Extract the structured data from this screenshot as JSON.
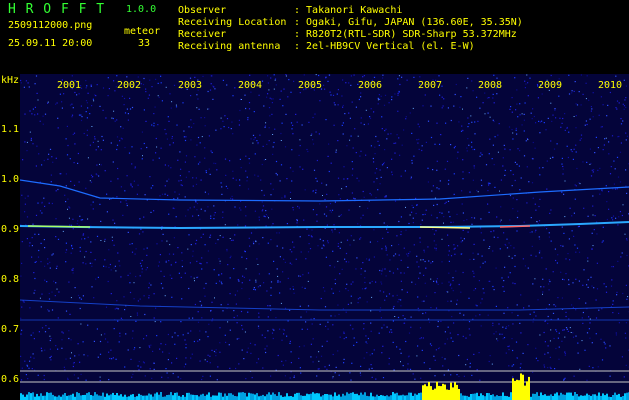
{
  "app": {
    "title": "H R O F F T",
    "version": "1.0.0",
    "filename": "2509112000.png",
    "datetime": "25.09.11 20:00",
    "meteor_label": "meteor",
    "meteor_count": "33"
  },
  "info": {
    "labels": [
      "Observer",
      "Receiving Location",
      "Receiver",
      "Receiving antenna"
    ],
    "values": [
      ": Takanori Kawachi",
      ": Ogaki, Gifu, JAPAN (136.60E, 35.35N)",
      ": R820T2(RTL-SDR) SDR-Sharp 53.372MHz",
      ": 2el-HB9CV Vertical (el. E-W)"
    ]
  },
  "axis": {
    "unit": "kHz",
    "y_ticks": [
      "1.1",
      "1.0",
      "0.9",
      "0.8",
      "0.7",
      "0.6"
    ],
    "x_ticks": [
      "2001",
      "2002",
      "2003",
      "2004",
      "2005",
      "2006",
      "2007",
      "2008",
      "2009",
      "2010"
    ]
  },
  "colors": {
    "background": "#000000",
    "text_yellow": "#ffff00",
    "text_green": "#33ff33",
    "noise": "#0a0a7a",
    "trace": "#33aaff"
  }
}
